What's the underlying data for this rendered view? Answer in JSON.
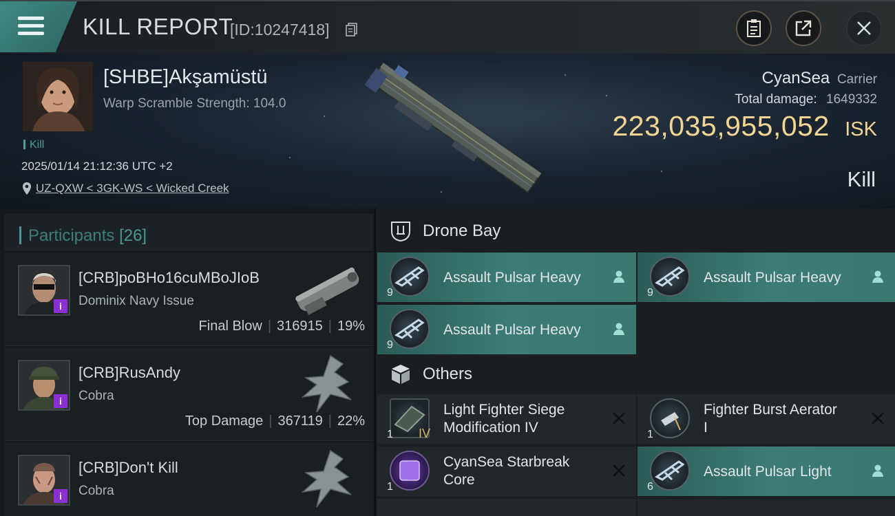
{
  "header": {
    "title": "KILL REPORT",
    "report_id": "[ID:10247418]",
    "icons": [
      "menu-icon",
      "copy-icon",
      "clipboard-icon",
      "share-icon",
      "close-icon"
    ]
  },
  "victim": {
    "name": "[SHBE]Akşamüstü",
    "subtitle": "Warp Scramble Strength: 104.0",
    "kill_tag": "Kill",
    "timestamp": "2025/01/14 21:12:36 UTC +2",
    "location": "UZ-QXW < 3GK-WS < Wicked Creek",
    "ship_name": "CyanSea",
    "ship_class": "Carrier",
    "total_damage_label": "Total damage:",
    "total_damage": "1649332",
    "isk_value": "223,035,955,052",
    "isk_unit": "ISK",
    "result": "Kill"
  },
  "participants": {
    "title": "Participants",
    "count": "[26]",
    "rows": [
      {
        "name": "[CRB]poBHo16cuMBoJIoB",
        "ship": "Dominix Navy Issue",
        "label": "Final Blow",
        "damage": "316915",
        "percent": "19%"
      },
      {
        "name": "[CRB]RusAndy",
        "ship": "Cobra",
        "label": "Top Damage",
        "damage": "367119",
        "percent": "22%"
      },
      {
        "name": "[CRB]Don't Kill",
        "ship": "Cobra"
      }
    ]
  },
  "items": {
    "drone_bay": {
      "title": "Drone Bay",
      "entries": [
        {
          "name": "Assault Pulsar Heavy",
          "qty": "9",
          "status": "dropped"
        },
        {
          "name": "Assault Pulsar Heavy",
          "qty": "9",
          "status": "dropped"
        },
        {
          "name": "Assault Pulsar Heavy",
          "qty": "9",
          "status": "dropped"
        }
      ]
    },
    "others": {
      "title": "Others",
      "entries": [
        {
          "name_line1": "Light Fighter Siege",
          "name_line2": "Modification IV",
          "qty": "1",
          "meta": "IV",
          "status": "destroyed"
        },
        {
          "name_line1": "Fighter Burst Aerator",
          "name_line2": "I",
          "qty": "1",
          "status": "destroyed"
        },
        {
          "name_line1": "CyanSea Starbreak",
          "name_line2": "Core",
          "qty": "1",
          "status": "destroyed"
        },
        {
          "name_line1": "Assault Pulsar Light",
          "name_line2": "",
          "qty": "6",
          "status": "dropped"
        }
      ]
    }
  },
  "colors": {
    "accent_teal": "#47998f",
    "isk_gold": "#f0d595",
    "badge_purple": "#8a2fd1"
  }
}
